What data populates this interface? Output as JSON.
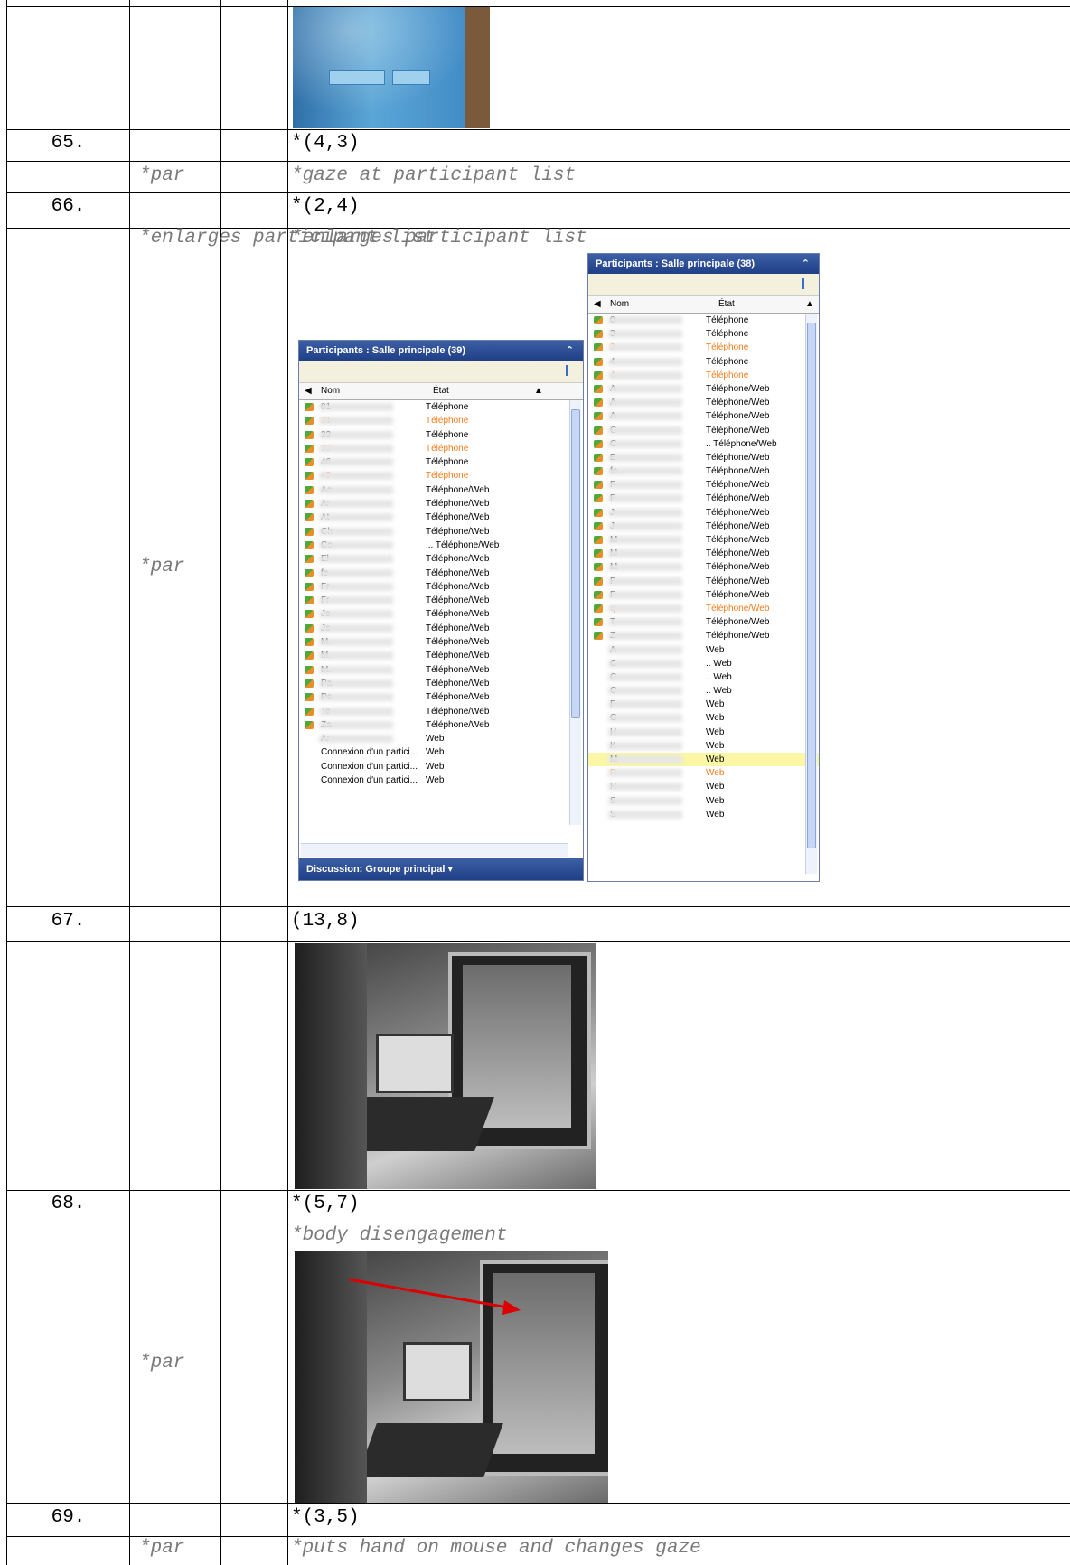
{
  "rows": [
    {
      "num": "65.",
      "code": "*(4,3)"
    },
    {
      "speaker": "*par",
      "annotation": "*gaze at participant list"
    },
    {
      "num": "66.",
      "code": "*(2,4)"
    },
    {
      "speaker": "*par",
      "annotation": "*enlarges participant list"
    },
    {
      "num": "67.",
      "code": "(13,8)"
    },
    {
      "num": "68.",
      "code": "*(5,7)"
    },
    {
      "speaker": "*par",
      "annotation": "*body disengagement"
    },
    {
      "num": "69.",
      "code": "*(3,5)"
    },
    {
      "speaker": "*par",
      "annotation": "*puts hand on mouse and changes gaze"
    }
  ],
  "panel_small": {
    "title": "Participants : Salle principale (39)",
    "col_name": "Nom",
    "col_state": "État",
    "footer": "Discussion: Groupe principal ▾",
    "rows": [
      {
        "name": "01",
        "state": "Téléphone",
        "orange": false
      },
      {
        "name": "31",
        "state": "Téléphone",
        "orange": true
      },
      {
        "name": "33",
        "state": "Téléphone",
        "orange": false
      },
      {
        "name": "33",
        "state": "Téléphone",
        "orange": true
      },
      {
        "name": "46",
        "state": "Téléphone",
        "orange": false
      },
      {
        "name": "49",
        "state": "Téléphone",
        "orange": true
      },
      {
        "name": "Ac",
        "state": "Téléphone/Web",
        "orange": false
      },
      {
        "name": "Ar",
        "state": "Téléphone/Web",
        "orange": false
      },
      {
        "name": "At",
        "state": "Téléphone/Web",
        "orange": false
      },
      {
        "name": "Ch",
        "state": "Téléphone/Web",
        "orange": false
      },
      {
        "name": "Co",
        "state": "... Téléphone/Web",
        "orange": false
      },
      {
        "name": "El",
        "state": "Téléphone/Web",
        "orange": false
      },
      {
        "name": "fe",
        "state": "Téléphone/Web",
        "orange": false
      },
      {
        "name": "Fr",
        "state": "Téléphone/Web",
        "orange": false
      },
      {
        "name": "Fr",
        "state": "Téléphone/Web",
        "orange": false
      },
      {
        "name": "Jc",
        "state": "Téléphone/Web",
        "orange": false
      },
      {
        "name": "Jc",
        "state": "Téléphone/Web",
        "orange": false
      },
      {
        "name": "M.",
        "state": "Téléphone/Web",
        "orange": false
      },
      {
        "name": "M.",
        "state": "Téléphone/Web",
        "orange": false
      },
      {
        "name": "M.",
        "state": "Téléphone/Web",
        "orange": false
      },
      {
        "name": "Pa",
        "state": "Téléphone/Web",
        "orange": false
      },
      {
        "name": "Pe",
        "state": "Téléphone/Web",
        "orange": false
      },
      {
        "name": "Te",
        "state": "Téléphone/Web",
        "orange": false
      },
      {
        "name": "Za",
        "state": "Téléphone/Web",
        "orange": false
      },
      {
        "name": "Ar",
        "state": "Web",
        "orange": false
      },
      {
        "name": "Connexion d'un partici...",
        "state": "Web",
        "orange": false
      },
      {
        "name": "Connexion d'un partici...",
        "state": "Web",
        "orange": false
      },
      {
        "name": "Connexion d'un partici...",
        "state": "Web",
        "orange": false
      }
    ]
  },
  "panel_large": {
    "title": "Participants : Salle principale (38)",
    "col_name": "Nom",
    "col_state": "État",
    "rows": [
      {
        "name": "0",
        "state": "Téléphone",
        "orange": false
      },
      {
        "name": "3",
        "state": "Téléphone",
        "orange": false
      },
      {
        "name": "3",
        "state": "Téléphone",
        "orange": true
      },
      {
        "name": "4",
        "state": "Téléphone",
        "orange": false
      },
      {
        "name": "4",
        "state": "Téléphone",
        "orange": true
      },
      {
        "name": "A",
        "state": "Téléphone/Web",
        "orange": false
      },
      {
        "name": "A",
        "state": "Téléphone/Web",
        "orange": false
      },
      {
        "name": "A",
        "state": "Téléphone/Web",
        "orange": false
      },
      {
        "name": "C",
        "state": "Téléphone/Web",
        "orange": false
      },
      {
        "name": "C",
        "state": ".. Téléphone/Web",
        "orange": false
      },
      {
        "name": "E",
        "state": "Téléphone/Web",
        "orange": false
      },
      {
        "name": "fe",
        "state": "Téléphone/Web",
        "orange": false
      },
      {
        "name": "F",
        "state": "Téléphone/Web",
        "orange": false
      },
      {
        "name": "F",
        "state": "Téléphone/Web",
        "orange": false
      },
      {
        "name": "J",
        "state": "Téléphone/Web",
        "orange": false
      },
      {
        "name": "J",
        "state": "Téléphone/Web",
        "orange": false
      },
      {
        "name": "M",
        "state": "Téléphone/Web",
        "orange": false
      },
      {
        "name": "M",
        "state": "Téléphone/Web",
        "orange": false
      },
      {
        "name": "M",
        "state": "Téléphone/Web",
        "orange": false
      },
      {
        "name": "P",
        "state": "Téléphone/Web",
        "orange": false
      },
      {
        "name": "P",
        "state": "Téléphone/Web",
        "orange": false
      },
      {
        "name": "q",
        "state": "Téléphone/Web",
        "orange": true
      },
      {
        "name": "T",
        "state": "Téléphone/Web",
        "orange": false
      },
      {
        "name": "Z",
        "state": "Téléphone/Web",
        "orange": false
      },
      {
        "name": "A",
        "state": "Web",
        "orange": false
      },
      {
        "name": "C",
        "state": ".. Web",
        "orange": false
      },
      {
        "name": "C",
        "state": ".. Web",
        "orange": false
      },
      {
        "name": "C",
        "state": ".. Web",
        "orange": false
      },
      {
        "name": "F",
        "state": "Web",
        "orange": false
      },
      {
        "name": "G",
        "state": "Web",
        "orange": false
      },
      {
        "name": "H",
        "state": "Web",
        "orange": false
      },
      {
        "name": "K",
        "state": "Web",
        "orange": false
      },
      {
        "name": "M",
        "state": "Web",
        "orange": false,
        "selected": true
      },
      {
        "name": "R",
        "state": "Web",
        "orange": true
      },
      {
        "name": "R",
        "state": "Web",
        "orange": false
      },
      {
        "name": "S",
        "state": "Web",
        "orange": false
      },
      {
        "name": "S",
        "state": "Web",
        "orange": false
      }
    ]
  }
}
